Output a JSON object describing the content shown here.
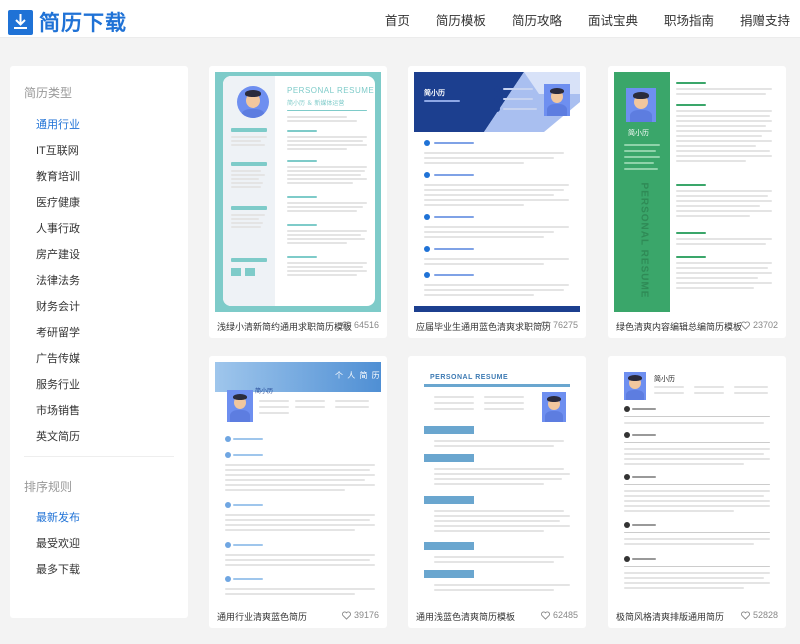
{
  "logo": {
    "text": "简历下载"
  },
  "nav": [
    "首页",
    "简历模板",
    "简历攻略",
    "面试宝典",
    "职场指南",
    "捐赠支持"
  ],
  "sidebar": {
    "category_title": "简历类型",
    "categories": [
      "通用行业",
      "IT互联网",
      "教育培训",
      "医疗健康",
      "人事行政",
      "房产建设",
      "法律法务",
      "财务会计",
      "考研留学",
      "广告传媒",
      "服务行业",
      "市场销售",
      "英文简历"
    ],
    "active_category": "通用行业",
    "sort_title": "排序规则",
    "sorts": [
      "最新发布",
      "最受欢迎",
      "最多下载"
    ],
    "active_sort": "最新发布"
  },
  "cards": [
    {
      "title": "浅绿小清新简约通用求职简历模板",
      "likes": "64516",
      "header_text": "PERSONAL RESUME",
      "name": "简小历 ＆ 新媒体运营"
    },
    {
      "title": "应届毕业生通用蓝色清爽求职简历",
      "likes": "76275",
      "name": "简小历"
    },
    {
      "title": "绿色清爽内容编辑总编简历模板",
      "likes": "23702",
      "side_text": "PERSONAL RESUME",
      "name": "简小历"
    },
    {
      "title": "通用行业清爽蓝色简历",
      "likes": "39176",
      "header_text": "个 人 简 历",
      "name": "简小历"
    },
    {
      "title": "通用浅蓝色清爽简历模板",
      "likes": "62485",
      "header_text": "PERSONAL RESUME"
    },
    {
      "title": "极简风格清爽排版通用简历",
      "likes": "52828",
      "name": "简小历"
    }
  ],
  "colors": {
    "brand": "#1f72d6",
    "teal": "#7ecbc9",
    "green": "#3aa66a",
    "navy": "#1c3f8f"
  }
}
